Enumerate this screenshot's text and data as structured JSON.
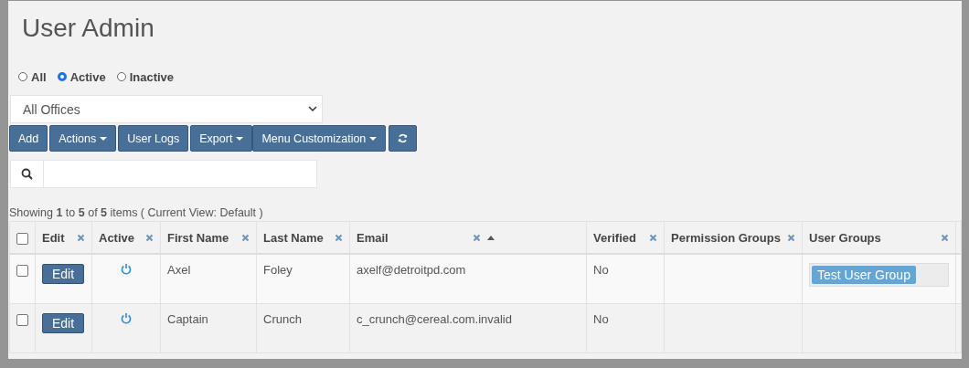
{
  "title": "User Admin",
  "status_filter": [
    {
      "label": "All",
      "selected": false
    },
    {
      "label": "Active",
      "selected": true
    },
    {
      "label": "Inactive",
      "selected": false
    }
  ],
  "office_select": {
    "value": "All Offices"
  },
  "toolbar": [
    {
      "label": "Add",
      "kind": "plain"
    },
    {
      "label": "Actions",
      "kind": "dropdown"
    },
    {
      "label": "User Logs",
      "kind": "plain"
    },
    {
      "label": "Export",
      "kind": "dropdown"
    },
    {
      "label": "Menu Customization",
      "kind": "dropdown"
    },
    {
      "kind": "refresh"
    }
  ],
  "summary": "Showing **1** to **5** of **5** items ( Current View: Default )",
  "table": {
    "select_all": {
      "checked": false
    },
    "columns": [
      {
        "label": "Edit",
        "sorted": false
      },
      {
        "label": "Active",
        "sorted": false
      },
      {
        "label": "First Name",
        "sorted": false
      },
      {
        "label": "Last Name",
        "sorted": false
      },
      {
        "label": "Email",
        "sorted": true
      },
      {
        "label": "Verified",
        "sorted": false
      },
      {
        "label": "Permission Groups",
        "sorted": false
      },
      {
        "label": "User Groups",
        "sorted": false
      }
    ],
    "rows": [
      {
        "checked": false,
        "edit": "Edit",
        "active": true,
        "first_name": "Axel",
        "last_name": "Foley",
        "email": "axelf@detroitpd.com",
        "verified": "No",
        "user_groups": [
          "Test User Group"
        ]
      },
      {
        "checked": false,
        "edit": "Edit",
        "active": true,
        "first_name": "Captain",
        "last_name": "Crunch",
        "email": "c_crunch@cereal.com.invalid",
        "verified": "No",
        "user_groups": []
      }
    ]
  }
}
